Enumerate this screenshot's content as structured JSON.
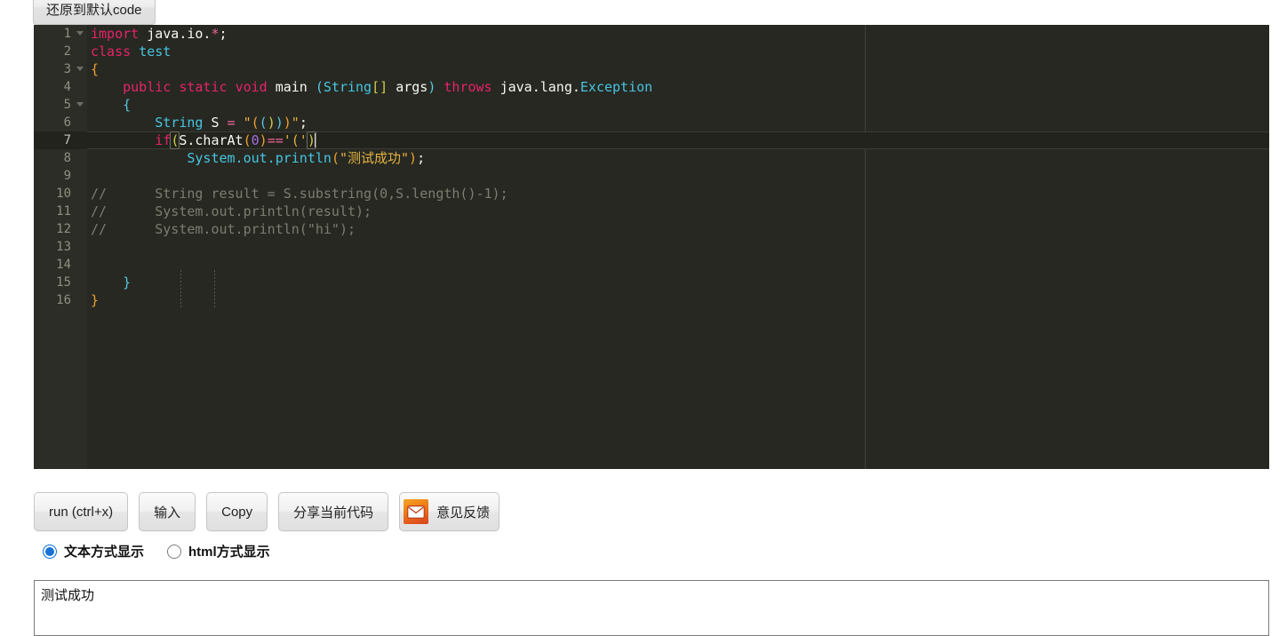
{
  "toolbar": {
    "restore_label": "还原到默认code"
  },
  "editor": {
    "language": "java",
    "active_line": 7,
    "total_lines": 16,
    "theme_bg": "#272822",
    "gutter_bg": "#2c2d26",
    "lines": [
      {
        "n": "1",
        "fold": true
      },
      {
        "n": "2",
        "fold": false
      },
      {
        "n": "3",
        "fold": true
      },
      {
        "n": "4",
        "fold": false
      },
      {
        "n": "5",
        "fold": true
      },
      {
        "n": "6",
        "fold": false
      },
      {
        "n": "7",
        "fold": false
      },
      {
        "n": "8",
        "fold": false
      },
      {
        "n": "9",
        "fold": false
      },
      {
        "n": "10",
        "fold": false
      },
      {
        "n": "11",
        "fold": false
      },
      {
        "n": "12",
        "fold": false
      },
      {
        "n": "13",
        "fold": false
      },
      {
        "n": "14",
        "fold": false
      },
      {
        "n": "15",
        "fold": false
      },
      {
        "n": "16",
        "fold": false
      }
    ],
    "code_lines": [
      "import java.io.*;",
      "class test",
      "{",
      "    public static void main (String[] args) throws java.lang.Exception",
      "    {",
      "        String S = \"(()))\";",
      "        if(S.charAt(0)=='(')",
      "            System.out.println(\"测试成功\");",
      "",
      "//      String result = S.substring(0,S.length()-1);",
      "//      System.out.println(result);",
      "//      System.out.println(\"hi\");",
      "",
      "",
      "    }",
      "}"
    ]
  },
  "buttons": {
    "run": "run (ctrl+x)",
    "input": "输入",
    "copy": "Copy",
    "share": "分享当前代码",
    "feedback": "意见反馈",
    "feedback_icon": "mail-icon"
  },
  "display_mode": {
    "options": [
      {
        "label": "文本方式显示",
        "selected": true
      },
      {
        "label": "html方式显示",
        "selected": false
      }
    ]
  },
  "output": {
    "text": "测试成功"
  },
  "colors": {
    "accent": "#1673d6",
    "keyword": "#e6236a",
    "type": "#46c5e0",
    "string": "#e3b341",
    "number": "#a96ce0",
    "comment": "#7c7d70"
  }
}
